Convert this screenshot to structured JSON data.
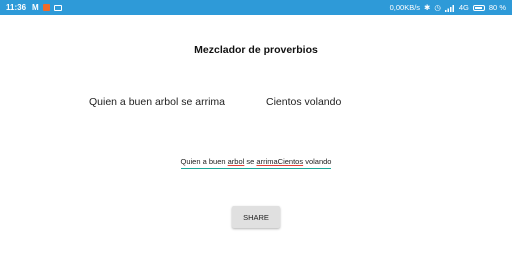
{
  "status_bar": {
    "time": "11:36",
    "m_icon": "M",
    "data_rate": "0,00KB/s",
    "network": "4G",
    "battery_percent": "80 %",
    "color": "#2e9ad8"
  },
  "title": "Mezclador de proverbios",
  "phrase_left": "Quien a buen arbol se arrima",
  "phrase_right": "Cientos volando",
  "result": {
    "part1": "Quien a buen ",
    "part2": "arbol",
    "part3": " se ",
    "part4": "arrimaCientos",
    "part5": " volando"
  },
  "share_button": "SHARE"
}
